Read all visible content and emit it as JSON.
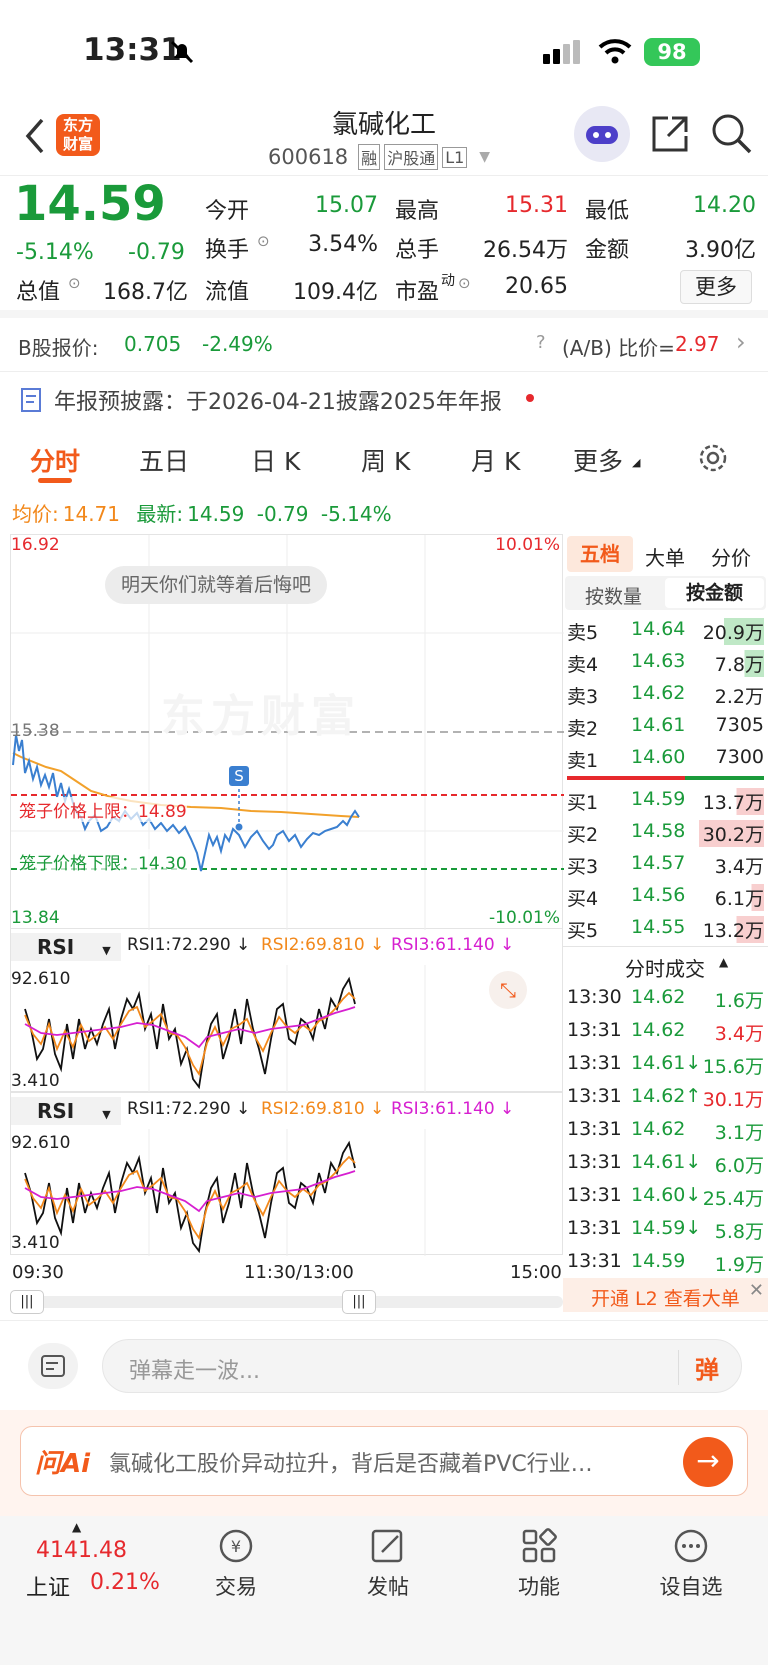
{
  "status": {
    "time": "13:31",
    "battery": "98"
  },
  "header": {
    "logo": "东方\n财富",
    "title": "氯碱化工",
    "code": "600618",
    "tags": [
      "融",
      "沪股通",
      "L1"
    ]
  },
  "quote": {
    "price": "14.59",
    "pct": "-5.14%",
    "chg": "-0.79",
    "fields": [
      {
        "label": "今开",
        "value": "15.07"
      },
      {
        "label": "最高",
        "value": "15.31"
      },
      {
        "label": "最低",
        "value": "14.20"
      },
      {
        "label": "换手",
        "value": "3.54%"
      },
      {
        "label": "总手",
        "value": "26.54万"
      },
      {
        "label": "金额",
        "value": "3.90亿"
      },
      {
        "label": "总值",
        "value": "168.7亿"
      },
      {
        "label": "流值",
        "value": "109.4亿"
      },
      {
        "label": "市盈",
        "sup": "动",
        "value": "20.65"
      }
    ],
    "more": "更多"
  },
  "bshare": {
    "label": "B股报价:",
    "price": "0.705",
    "pct": "-2.49%",
    "ratio_label": "(A/B) 比价=",
    "ratio": "2.97"
  },
  "notice": {
    "text": "年报预披露：于2026-04-21披露2025年年报"
  },
  "tabs": [
    "分时",
    "五日",
    "日 K",
    "周 K",
    "月 K",
    "更多"
  ],
  "avg": {
    "label": "均价:",
    "value": "14.71",
    "latest_label": "最新:",
    "latest": "14.59",
    "chg": "-0.79",
    "pct": "-5.14%"
  },
  "chart": {
    "high": "16.92",
    "high_pct": "10.01%",
    "low": "13.84",
    "low_pct": "-10.01%",
    "prev": "15.38",
    "barrage": "明天你们就等着后悔吧",
    "watermark": "东方财富",
    "upper": "笼子价格上限：14.89",
    "lower": "笼子价格下限：14.30",
    "marker": "S"
  },
  "rsi": {
    "label": "RSI",
    "r1": "RSI1:72.290 ↓",
    "r2": "RSI2:69.810 ↓",
    "r3": "RSI3:61.140 ↓",
    "max": "92.610",
    "min": "3.410"
  },
  "time_axis": [
    "09:30",
    "11:30/13:00",
    "15:00"
  ],
  "book": {
    "tabs": [
      "五档",
      "大单",
      "分价"
    ],
    "subtabs": [
      "按数量",
      "按金额"
    ],
    "asks": [
      {
        "l": "卖5",
        "p": "14.64",
        "v": "20.9万"
      },
      {
        "l": "卖4",
        "p": "14.63",
        "v": "7.8万"
      },
      {
        "l": "卖3",
        "p": "14.62",
        "v": "2.2万"
      },
      {
        "l": "卖2",
        "p": "14.61",
        "v": "7305"
      },
      {
        "l": "卖1",
        "p": "14.60",
        "v": "7300"
      }
    ],
    "bids": [
      {
        "l": "买1",
        "p": "14.59",
        "v": "13.7万"
      },
      {
        "l": "买2",
        "p": "14.58",
        "v": "30.2万"
      },
      {
        "l": "买3",
        "p": "14.57",
        "v": "3.4万"
      },
      {
        "l": "买4",
        "p": "14.56",
        "v": "6.1万"
      },
      {
        "l": "买5",
        "p": "14.55",
        "v": "13.2万"
      }
    ]
  },
  "trades": {
    "title": "分时成交",
    "rows": [
      {
        "t": "13:30",
        "p": "14.62",
        "v": "1.6万",
        "c": "green"
      },
      {
        "t": "13:31",
        "p": "14.62",
        "v": "3.4万",
        "c": "red"
      },
      {
        "t": "13:31",
        "p": "14.61↓",
        "v": "15.6万",
        "c": "green"
      },
      {
        "t": "13:31",
        "p": "14.62↑",
        "v": "30.1万",
        "c": "red"
      },
      {
        "t": "13:31",
        "p": "14.62",
        "v": "3.1万",
        "c": "green"
      },
      {
        "t": "13:31",
        "p": "14.61↓",
        "v": "6.0万",
        "c": "green"
      },
      {
        "t": "13:31",
        "p": "14.60↓",
        "v": "25.4万",
        "c": "green"
      },
      {
        "t": "13:31",
        "p": "14.59↓",
        "v": "5.8万",
        "c": "green"
      },
      {
        "t": "13:31",
        "p": "14.59",
        "v": "1.9万",
        "c": "green"
      }
    ],
    "l2": "开通 L2 查看大单"
  },
  "comment": {
    "placeholder": "弹幕走一波...",
    "send": "弹"
  },
  "ai": {
    "brand": "问Ai",
    "text": "氯碱化工股价异动拉升，背后是否藏着PVC行业…"
  },
  "nav": {
    "index": "4141.48",
    "index_name": "上证",
    "index_pct": "0.21%",
    "items": [
      "交易",
      "发帖",
      "功能",
      "设自选"
    ]
  }
}
